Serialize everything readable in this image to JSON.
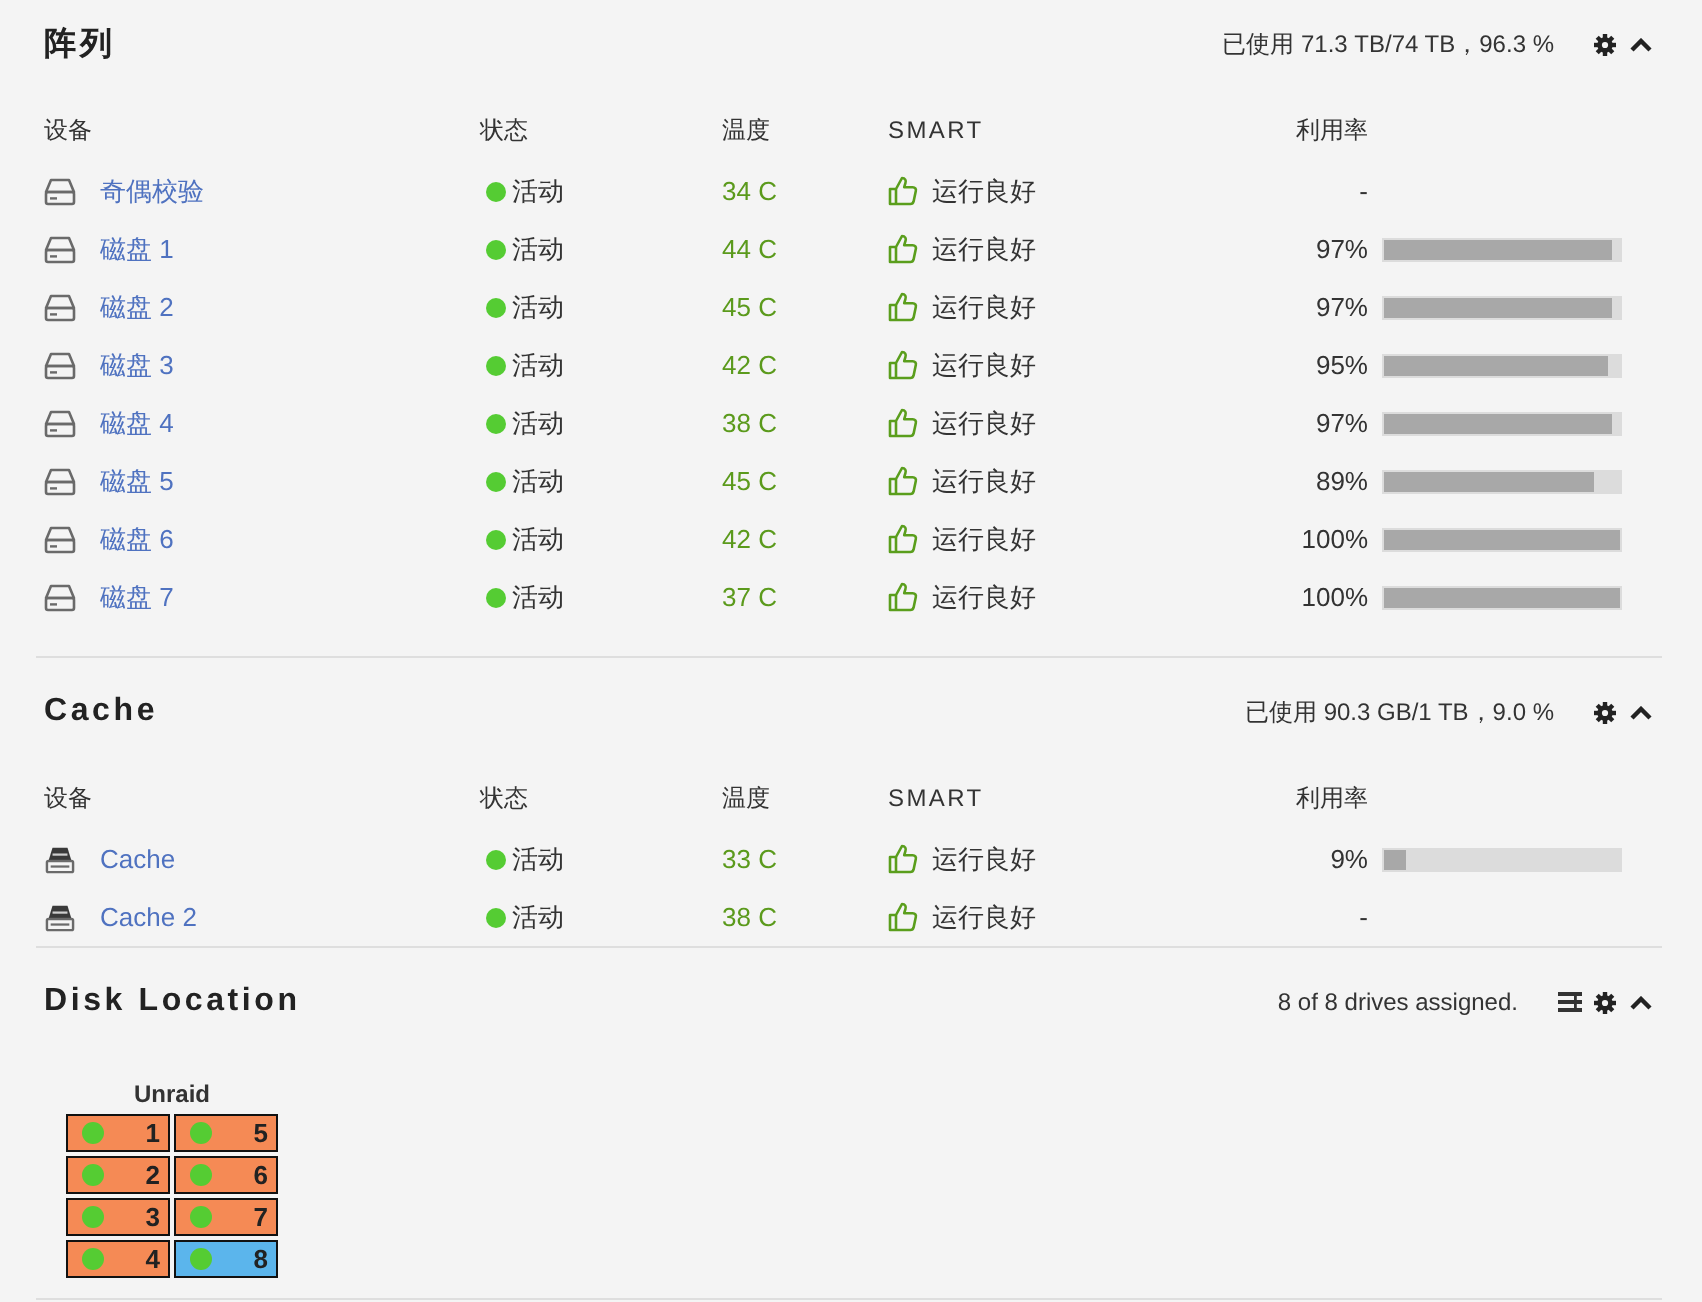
{
  "sections": [
    {
      "kind": "disks",
      "title": "阵列",
      "summary": "已使用 71.3 TB/74 TB，96.3 %",
      "expanded": true,
      "columns": [
        "设备",
        "状态",
        "温度",
        "SMART",
        "利用率"
      ],
      "rows": [
        {
          "device": "奇偶校验",
          "status": "活动",
          "temperature": "34 C",
          "smart": "运行良好",
          "usage": "-"
        },
        {
          "device": "磁盘 1",
          "status": "活动",
          "temperature": "44 C",
          "smart": "运行良好",
          "usage": "97%",
          "level": 0.97
        },
        {
          "device": "磁盘 2",
          "status": "活动",
          "temperature": "45 C",
          "smart": "运行良好",
          "usage": "97%",
          "level": 0.97
        },
        {
          "device": "磁盘 3",
          "status": "活动",
          "temperature": "42 C",
          "smart": "运行良好",
          "usage": "95%",
          "level": 0.95
        },
        {
          "device": "磁盘 4",
          "status": "活动",
          "temperature": "38 C",
          "smart": "运行良好",
          "usage": "97%",
          "level": 0.97
        },
        {
          "device": "磁盘 5",
          "status": "活动",
          "temperature": "45 C",
          "smart": "运行良好",
          "usage": "89%",
          "level": 0.89
        },
        {
          "device": "磁盘 6",
          "status": "活动",
          "temperature": "42 C",
          "smart": "运行良好",
          "usage": "100%",
          "level": 1
        },
        {
          "device": "磁盘 7",
          "status": "活动",
          "temperature": "37 C",
          "smart": "运行良好",
          "usage": "100%",
          "level": 1
        }
      ]
    },
    {
      "kind": "pool",
      "title": "Cache",
      "summary": "已使用 90.3 GB/1 TB，9.0 %",
      "expanded": true,
      "columns": [
        "设备",
        "状态",
        "温度",
        "SMART",
        "利用率"
      ],
      "rows": [
        {
          "device": "Cache",
          "status": "活动",
          "temperature": "33 C",
          "smart": "运行良好",
          "usage": "9%",
          "level": 0.09
        },
        {
          "device": "Cache 2",
          "status": "活动",
          "temperature": "38 C",
          "smart": "运行良好",
          "usage": "-"
        }
      ]
    },
    {
      "kind": "locator",
      "title": "Disk Location",
      "summary": "8 of 8 drives assigned.",
      "expanded": true,
      "tray": {
        "label": "Unraid",
        "slots": [
          {
            "number": "1",
            "color": "#f58a55"
          },
          {
            "number": "2",
            "color": "#f58a55"
          },
          {
            "number": "3",
            "color": "#f58a55"
          },
          {
            "number": "4",
            "color": "#f58a55"
          },
          {
            "number": "5",
            "color": "#f58a55"
          },
          {
            "number": "6",
            "color": "#f58a55"
          },
          {
            "number": "7",
            "color": "#f58a55"
          },
          {
            "number": "8",
            "color": "#5bb5ec"
          }
        ]
      }
    }
  ]
}
